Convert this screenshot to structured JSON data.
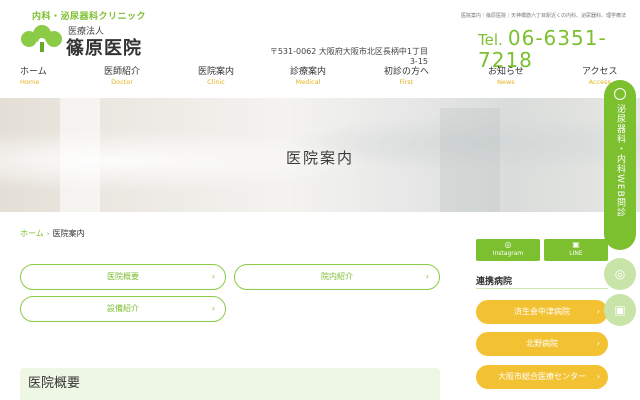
{
  "header": {
    "tagline": "内科・泌尿器科クリニック",
    "corp": "医療法人",
    "clinic_name": "篠原医院",
    "seo_line": "医院案内｜篠原医院｜天神橋筋六丁目駅近くの内科、泌尿器科、理学療法",
    "address_line1": "〒531-0062 大阪府大阪市北区長柄中1丁目",
    "address_line2": "3-15",
    "tel_label": "Tel.",
    "tel_number": "06-6351-7218"
  },
  "nav": [
    {
      "jp": "ホーム",
      "en": "Home"
    },
    {
      "jp": "医師紹介",
      "en": "Doctor"
    },
    {
      "jp": "医院案内",
      "en": "Clinic"
    },
    {
      "jp": "診療案内",
      "en": "Medical"
    },
    {
      "jp": "初診の方へ",
      "en": "First"
    },
    {
      "jp": "お知らせ",
      "en": "News"
    },
    {
      "jp": "アクセス",
      "en": "Access"
    }
  ],
  "hero": {
    "title": "医院案内"
  },
  "breadcrumb": {
    "home": "ホーム",
    "separator": "›",
    "current": "医院案内"
  },
  "sections": {
    "buttons": [
      "医院概要",
      "院内紹介",
      "設備紹介"
    ],
    "heading": "医院概要"
  },
  "sidebar": {
    "sns": [
      {
        "icon": "◎",
        "label": "Instagram"
      },
      {
        "icon": "▣",
        "label": "LINE"
      }
    ],
    "partner_title": "連携病院",
    "partners": [
      "済生会中津病院",
      "北野病院",
      "大阪市総合医療センター"
    ]
  },
  "float": {
    "web_booking": "泌尿器科・内科WEB問診",
    "instagram_icon": "◎",
    "line_icon": "▣"
  },
  "chevron": "›",
  "colors": {
    "green": "#7cbf2f",
    "yellow": "#f2c232",
    "orange_text": "#e6b322"
  }
}
